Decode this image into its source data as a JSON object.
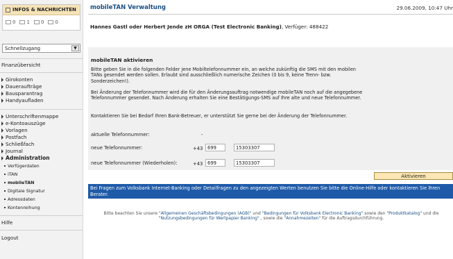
{
  "sidebar": {
    "info_title": "INFOS & NACHRICHTEN",
    "counts": [
      {
        "icon": "mail-icon",
        "value": "0"
      },
      {
        "icon": "document-icon",
        "value": "1"
      },
      {
        "icon": "message-icon",
        "value": "0"
      },
      {
        "icon": "note-icon",
        "value": "0"
      }
    ],
    "quick_access": "Schnellzugang",
    "overview": "Finanzübersicht",
    "group1": [
      "Girokonten",
      "Daueraufträge",
      "Bausparantrag",
      "Handyaufladen"
    ],
    "group2": [
      "Unterschriftenmappe",
      "e-Kontoauszüge",
      "Vorlagen",
      "Postfach",
      "Schließfach",
      "Journal"
    ],
    "administration": "Administration",
    "admin_items": [
      "Verfügerdaten",
      "iTAN",
      "mobileTAN",
      "Digitale Signatur",
      "Adressdaten",
      "Kontenreihung"
    ],
    "help": "Hilfe",
    "logout": "Logout"
  },
  "main": {
    "title": "mobileTAN Verwaltung",
    "timestamp": "29.06.2009, 10:47 Uhr",
    "subject_name": "Hannes Gastl oder Herbert Jende zH ORGA (Test Electronic Banking)",
    "subject_suffix": ", Verfüger: 488422",
    "panel": {
      "title": "mobileTAN aktivieren",
      "para1": "Bitte geben Sie in die folgenden Felder jene Mobiltelefonnummer ein, an welche zukünftig die SMS mit den mobilen TANs gesendet werden sollen. Erlaubt sind ausschließlich numerische Zeichen (0 bis 9, keine Trenn- bzw. Sonderzeichen!).",
      "para2": "Bei Änderung der Telefonnummer wird die für den Änderungsauftrag notwendige mobileTAN noch auf die angegebene Telefonnummer gesendet. Nach Änderung erhalten Sie eine Bestätigungs-SMS auf Ihre alte und neue Telefonnummer.",
      "para3": "Kontaktieren Sie bei Bedarf Ihren Bank-Betreuer, er unterstützt Sie gerne bei der Änderung der Telefonnummer.",
      "current_label": "aktuelle Telefonnummer:",
      "current_value": "-",
      "new_label": "neue Telefonnummer:",
      "repeat_label": "neue Telefonnummer (Wiederholen):",
      "country_code": "+43",
      "prefix": "699",
      "number": "15303307",
      "prefix_repeat": "699",
      "number_repeat": "15303307"
    },
    "activate_button": "Aktivieren",
    "help_text": "Bei Fragen zum Volksbank Internet-Banking oder Detailfragen zu den angezeigten Werten benutzen Sie bitte die Online-Hilfe oder kontaktieren Sie Ihren Berater.",
    "legal": {
      "t1": "Bitte beachten Sie unsere ",
      "l1": "\"Allgemeinen Geschäftsbedingungen (AGB)\"",
      "t2": " und ",
      "l2": "\"Bedingungen für Volksbank Electronic Banking\"",
      "t3": " sowie den ",
      "l3": "\"Produktkatalog\"",
      "t4": " und die ",
      "l4": "\"Nutzungsbedingungen für Wertpapier Banking\"",
      "t5": " , sowie die ",
      "l5": "\"Annahmezeiten\"",
      "t6": " für die Auftragsdurchführung."
    }
  },
  "colors": {
    "title_blue": "#1a4f86",
    "help_bar": "#1e5aa8",
    "button_bg": "#fbe7b3",
    "info_head": "#f5e3b8"
  }
}
